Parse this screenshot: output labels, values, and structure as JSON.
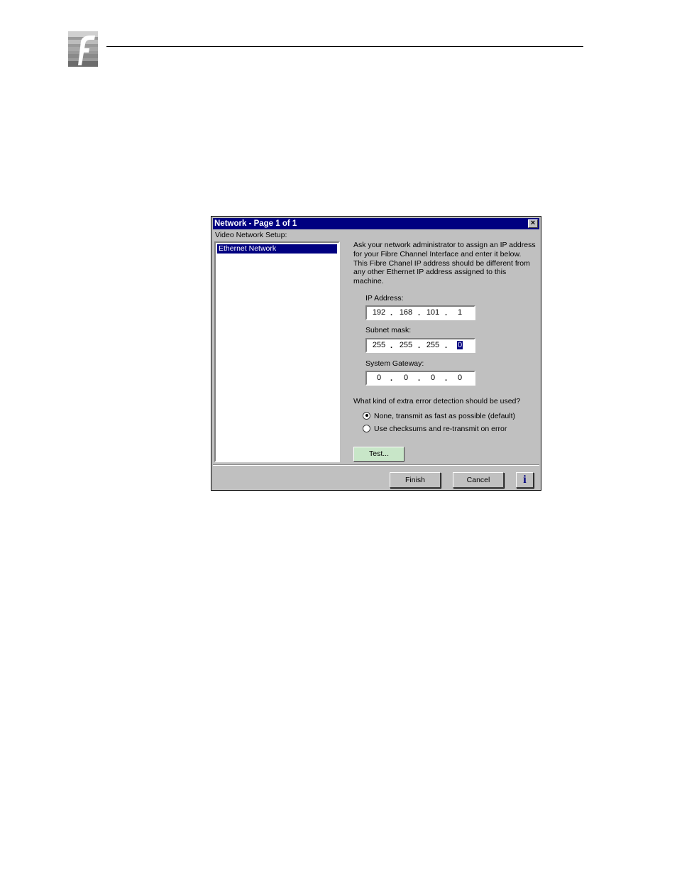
{
  "dialog": {
    "title": "Network - Page 1 of 1",
    "close_glyph": "×",
    "setup_label": "Video Network Setup:",
    "list_items": [
      "Ethernet Network"
    ],
    "instructions": "Ask your network administrator to assign an IP address for your Fibre Channel Interface and enter it below. This Fibre Chanel IP address should be different from any other Ethernet IP address assigned to this machine.",
    "ip_address": {
      "label": "IP Address:",
      "octets": [
        "192",
        "168",
        "101",
        "1"
      ]
    },
    "subnet_mask": {
      "label": "Subnet mask:",
      "octets": [
        "255",
        "255",
        "255",
        "0"
      ]
    },
    "system_gateway": {
      "label": "System Gateway:",
      "octets": [
        "0",
        "0",
        "0",
        "0"
      ]
    },
    "question": "What kind of extra error detection should be used?",
    "options": [
      {
        "label": "None, transmit as fast as possible (default)",
        "selected": true
      },
      {
        "label": "Use checksums and re-transmit on error",
        "selected": false
      }
    ],
    "test_label": "Test...",
    "finish_label": "Finish",
    "cancel_label": "Cancel",
    "info_label": "i"
  },
  "colors": {
    "titlebar": "#000080",
    "face": "#c0c0c0",
    "test_button": "#c8e6c8"
  },
  "icons": {
    "logo": "company-logo",
    "close": "close-icon",
    "info": "info-icon"
  }
}
